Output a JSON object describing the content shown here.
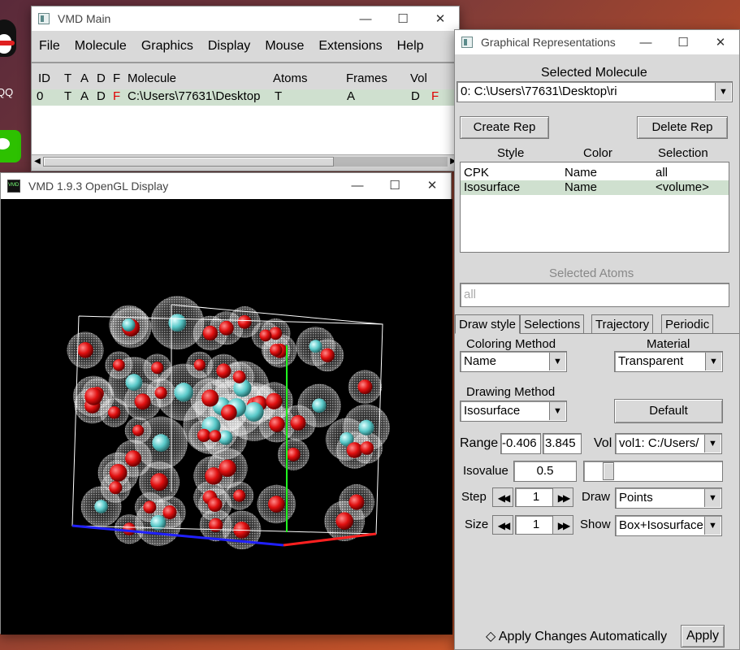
{
  "desktop": {
    "qq_label": "QQ"
  },
  "vmd_main": {
    "title": "VMD Main",
    "menus": [
      "File",
      "Molecule",
      "Graphics",
      "Display",
      "Mouse",
      "Extensions",
      "Help"
    ],
    "columns": {
      "id": "ID",
      "t": "T",
      "a": "A",
      "d": "D",
      "f": "F",
      "molecule": "Molecule",
      "atoms": "Atoms",
      "frames": "Frames",
      "vol": "Vol"
    },
    "rows": [
      {
        "id": "0",
        "t": "T",
        "a": "A",
        "d": "D",
        "f": "F",
        "molecule": "C:\\Users\\77631\\Desktop",
        "atoms": "T",
        "frames": "A",
        "vol_d": "D",
        "vol_f": "F"
      }
    ]
  },
  "gl_display": {
    "title": "VMD 1.9.3 OpenGL Display"
  },
  "graph_rep": {
    "title": "Graphical Representations",
    "selected_molecule_label": "Selected Molecule",
    "selected_molecule_value": "0: C:\\Users\\77631\\Desktop\\ri",
    "create_rep": "Create Rep",
    "delete_rep": "Delete Rep",
    "columns": {
      "style": "Style",
      "color": "Color",
      "selection": "Selection"
    },
    "reps": [
      {
        "style": "CPK",
        "color": "Name",
        "selection": "all"
      },
      {
        "style": "Isosurface",
        "color": "Name",
        "selection": "<volume>"
      }
    ],
    "selected_atoms_label": "Selected Atoms",
    "selected_atoms_value": "all",
    "tabs": [
      "Draw style",
      "Selections",
      "Trajectory",
      "Periodic"
    ],
    "coloring_method_label": "Coloring Method",
    "coloring_method_value": "Name",
    "material_label": "Material",
    "material_value": "Transparent",
    "drawing_method_label": "Drawing Method",
    "drawing_method_value": "Isosurface",
    "default_button": "Default",
    "range_label": "Range",
    "range_min": "-0.406",
    "range_max": "3.845",
    "vol_label": "Vol",
    "vol_value": "vol1: C:/Users/",
    "isovalue_label": "Isovalue",
    "isovalue_value": "0.5",
    "isovalue_slider": 0.15,
    "step_label": "Step",
    "step_value": "1",
    "draw_label": "Draw",
    "draw_value": "Points",
    "size_label": "Size",
    "size_value": "1",
    "show_label": "Show",
    "show_value": "Box+Isosurface",
    "apply_auto_label": "Apply Changes Automatically",
    "apply_button": "Apply"
  }
}
